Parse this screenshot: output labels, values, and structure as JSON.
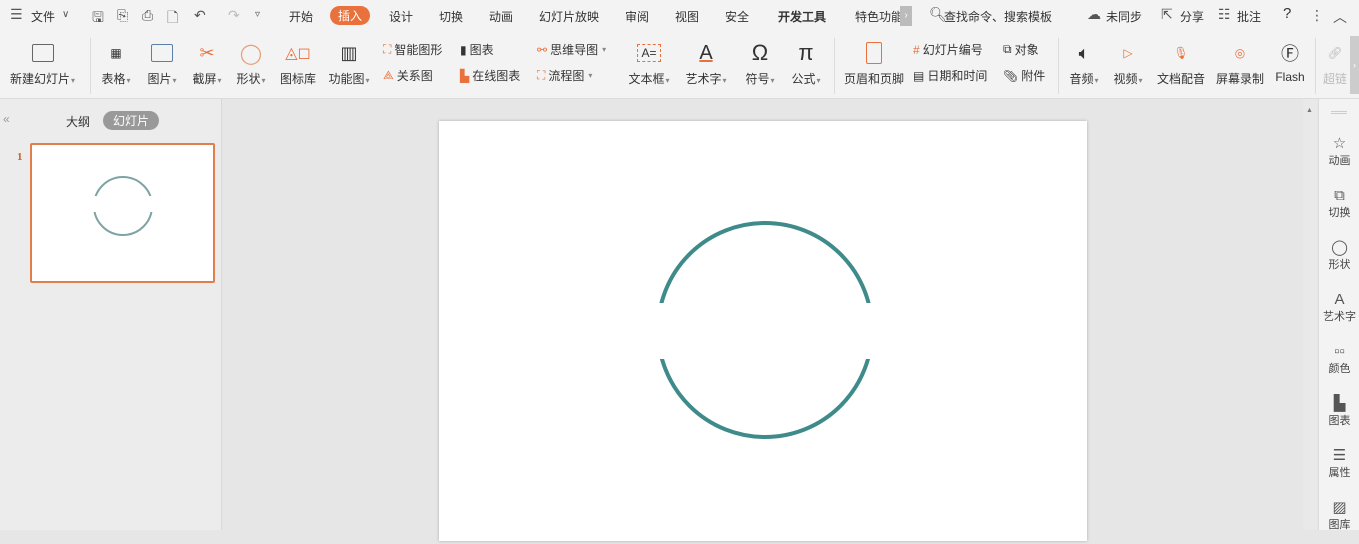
{
  "menu": {
    "file": "文件"
  },
  "tabs": [
    "开始",
    "插入",
    "设计",
    "切换",
    "动画",
    "幻灯片放映",
    "审阅",
    "视图",
    "安全",
    "开发工具",
    "特色功能"
  ],
  "active_tab": "插入",
  "search": "查找命令、搜索模板",
  "top_right": {
    "sync": "未同步",
    "share": "分享",
    "comment": "批注",
    "help": "?"
  },
  "ribbon": {
    "new_slide": "新建幻灯片",
    "table": "表格",
    "picture": "图片",
    "screenshot": "截屏",
    "shape": "形状",
    "icon_lib": "图标库",
    "func_chart": "功能图",
    "smart_art": "智能图形",
    "relation": "关系图",
    "chart": "图表",
    "online_chart": "在线图表",
    "mindmap": "思维导图",
    "flowchart": "流程图",
    "textbox": "文本框",
    "wordart": "艺术字",
    "symbol": "符号",
    "formula": "公式",
    "header_footer": "页眉和页脚",
    "slide_number": "幻灯片编号",
    "datetime": "日期和时间",
    "object": "对象",
    "attachment": "附件",
    "audio": "音频",
    "video": "视频",
    "doc_voice": "文档配音",
    "screen_record": "屏幕录制",
    "flash": "Flash",
    "hyperlink": "超链"
  },
  "left_panel": {
    "outline": "大纲",
    "slides": "幻灯片",
    "slide_numbers": [
      "1"
    ]
  },
  "side_panel": [
    "动画",
    "切换",
    "形状",
    "艺术字",
    "颜色",
    "图表",
    "属性",
    "图库"
  ],
  "colors": {
    "accent": "#e8713c",
    "circle": "#3f8a8a"
  }
}
